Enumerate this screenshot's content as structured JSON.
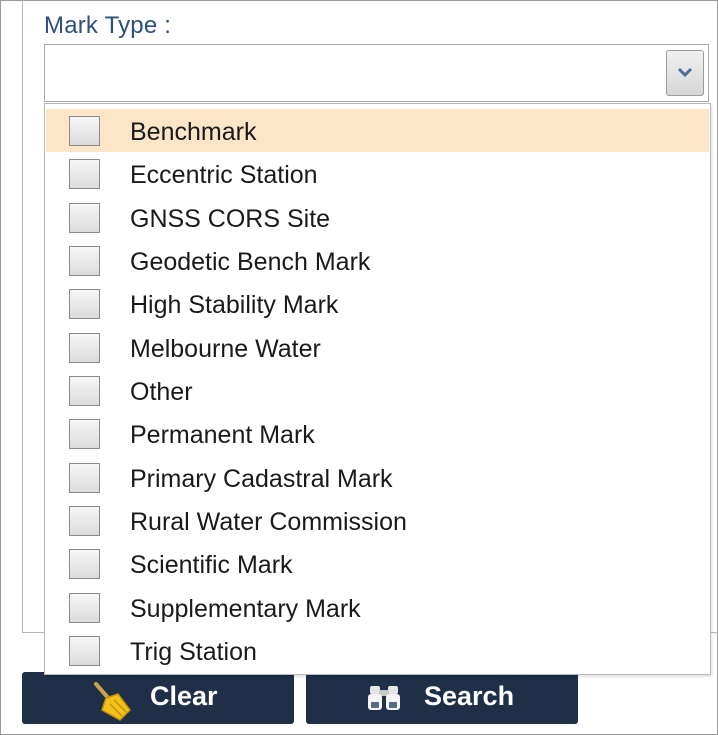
{
  "field": {
    "label": "Mark Type :",
    "value": ""
  },
  "dropdown": {
    "options": [
      {
        "label": "Benchmark",
        "checked": false
      },
      {
        "label": "Eccentric Station",
        "checked": false
      },
      {
        "label": "GNSS CORS Site",
        "checked": false
      },
      {
        "label": "Geodetic Bench Mark",
        "checked": false
      },
      {
        "label": "High Stability Mark",
        "checked": false
      },
      {
        "label": "Melbourne Water",
        "checked": false
      },
      {
        "label": "Other",
        "checked": false
      },
      {
        "label": "Permanent Mark",
        "checked": false
      },
      {
        "label": "Primary Cadastral Mark",
        "checked": false
      },
      {
        "label": "Rural Water Commission",
        "checked": false
      },
      {
        "label": "Scientific Mark",
        "checked": false
      },
      {
        "label": "Supplementary Mark",
        "checked": false
      },
      {
        "label": "Trig Station",
        "checked": false
      }
    ],
    "hovered_option": "Benchmark"
  },
  "buttons": {
    "clear_label": "Clear",
    "clear_icon": "broom-icon",
    "search_label": "Search",
    "search_icon": "binoculars-icon"
  },
  "colors": {
    "label": "#2f4f7f",
    "hover_row": "#fde6c8",
    "button_bg": "#1e2f47",
    "button_text": "#ffffff"
  }
}
